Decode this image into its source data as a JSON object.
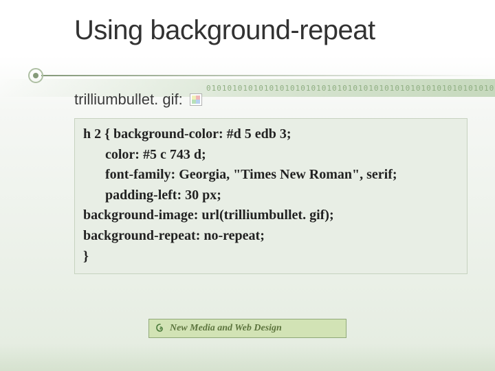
{
  "title": "Using background-repeat",
  "caption": "trilliumbullet. gif:",
  "code": {
    "l1": "h 2 { background-color: #d 5 edb 3;",
    "l2": "color: #5 c 743 d;",
    "l3": "font-family: Georgia, \"Times New Roman\", serif;",
    "l4": "padding-left: 30 px;",
    "l5": "background-image: url(trilliumbullet. gif);",
    "l6": "background-repeat: no-repeat;",
    "l7": "}"
  },
  "footer": "New Media and Web Design",
  "binary_decoration": "01010101010101010101010101010101010101010101010101010101"
}
